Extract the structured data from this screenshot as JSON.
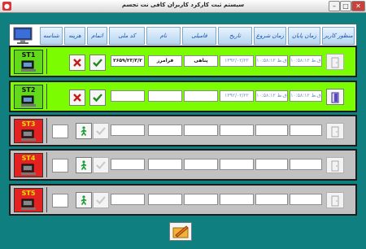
{
  "window": {
    "title": "سیستم ثبت کارکرد کاربران کافی نت تجسم"
  },
  "header": {
    "columns": [
      {
        "key": "monitor",
        "label": ""
      },
      {
        "key": "id",
        "label": "شناسه"
      },
      {
        "key": "cost",
        "label": "هزینه"
      },
      {
        "key": "finish",
        "label": "اتمام"
      },
      {
        "key": "code",
        "label": "کد ملی"
      },
      {
        "key": "name",
        "label": "نام"
      },
      {
        "key": "family",
        "label": "فامیلی"
      },
      {
        "key": "date",
        "label": "تاریخ"
      },
      {
        "key": "start_time",
        "label": "زمان شروع"
      },
      {
        "key": "end_time",
        "label": "زمان پایان"
      },
      {
        "key": "reserve",
        "label": "منظور کاربر"
      }
    ]
  },
  "rows": [
    {
      "station": "ST1",
      "state": "active",
      "id": "",
      "code": "۲۶۵۹/۲۳/۳/۲",
      "name": "فرامرز",
      "family": "پناهی",
      "date": "۱۳۹۲/۰۲/۲۲",
      "start_time": "ق.ظ ۱۰:۵۸:۱۲",
      "end_time": "ق.ظ ۱۰:۵۸:۱۲"
    },
    {
      "station": "ST2",
      "state": "active",
      "id": "",
      "code": "",
      "name": "",
      "family": "",
      "date": "۱۳۹۲/۰۲/۲۲",
      "start_time": "ق.ظ ۱۰:۵۸:۱۲",
      "end_time": "ق.ظ ۱۰:۵۸:۱۲"
    },
    {
      "station": "ST3",
      "state": "inactive",
      "id": "",
      "code": "",
      "name": "",
      "family": "",
      "date": "",
      "start_time": "",
      "end_time": ""
    },
    {
      "station": "ST4",
      "state": "inactive",
      "id": "",
      "code": "",
      "name": "",
      "family": "",
      "date": "",
      "start_time": "",
      "end_time": ""
    },
    {
      "station": "ST5",
      "state": "inactive",
      "id": "",
      "code": "",
      "name": "",
      "family": "",
      "date": "",
      "start_time": "",
      "end_time": ""
    }
  ],
  "icons": {
    "cancel": "red-x-icon",
    "confirm": "green-check-icon",
    "person": "walking-person-icon",
    "door": "door-icon",
    "save": "pencil-save-icon"
  },
  "colors": {
    "background": "#0f7f80",
    "active_row": "#7cfc00",
    "inactive_row": "#c2c2c2",
    "station_green": "#63d91c",
    "station_red": "#e42222"
  }
}
